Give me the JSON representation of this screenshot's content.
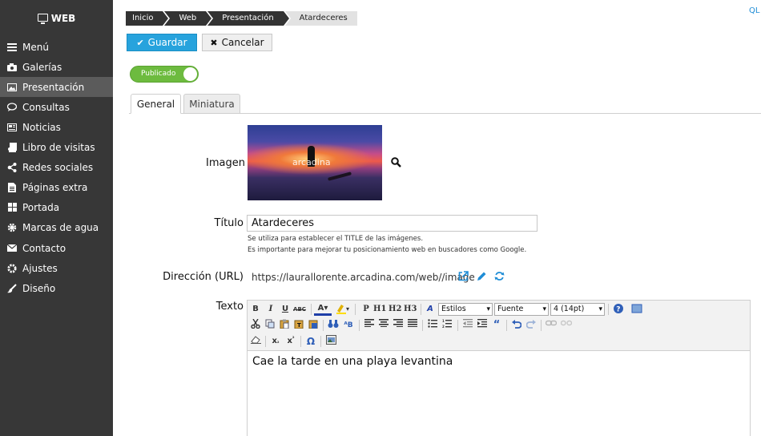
{
  "app": {
    "brand": "WEB",
    "quick_link": "QL"
  },
  "sidebar": {
    "items": [
      {
        "label": "Menú",
        "icon": "hamburger-icon"
      },
      {
        "label": "Galerías",
        "icon": "camera-icon"
      },
      {
        "label": "Presentación",
        "icon": "image-icon",
        "active": true
      },
      {
        "label": "Consultas",
        "icon": "chat-icon"
      },
      {
        "label": "Noticias",
        "icon": "newspaper-icon"
      },
      {
        "label": "Libro de visitas",
        "icon": "book-icon"
      },
      {
        "label": "Redes sociales",
        "icon": "share-icon"
      },
      {
        "label": "Páginas extra",
        "icon": "file-icon"
      },
      {
        "label": "Portada",
        "icon": "grid-icon"
      },
      {
        "label": "Marcas de agua",
        "icon": "gear-icon"
      },
      {
        "label": "Contacto",
        "icon": "envelope-icon"
      },
      {
        "label": "Ajustes",
        "icon": "cog-icon"
      },
      {
        "label": "Diseño",
        "icon": "brush-icon"
      }
    ]
  },
  "breadcrumb": [
    "Inicio",
    "Web",
    "Presentación",
    "Atardeceres"
  ],
  "toolbar": {
    "save_label": "Guardar",
    "cancel_label": "Cancelar"
  },
  "toggle": {
    "label": "Publicado",
    "on": true
  },
  "tabs": [
    {
      "label": "General",
      "active": true
    },
    {
      "label": "Miniatura",
      "active": false
    }
  ],
  "form": {
    "image_label": "Imagen",
    "image_watermark": "arcadina",
    "title_label": "Título",
    "title_value": "Atardeceres",
    "title_help_1": "Se utiliza para establecer el TITLE de las imágenes.",
    "title_help_2": "Es importante para mejorar tu posicionamiento web en buscadores como Google.",
    "url_label": "Dirección (URL)",
    "url_value": "https://laurallorente.arcadina.com/web//image",
    "text_label": "Texto"
  },
  "editor": {
    "styles_value": "Estilos",
    "font_value": "Fuente",
    "size_value": "4 (14pt)",
    "content": "Cae la tarde en una playa levantina"
  },
  "colors": {
    "sidebar_bg": "#373737",
    "accent": "#27a3dd",
    "toggle_on": "#6dbb3f"
  }
}
